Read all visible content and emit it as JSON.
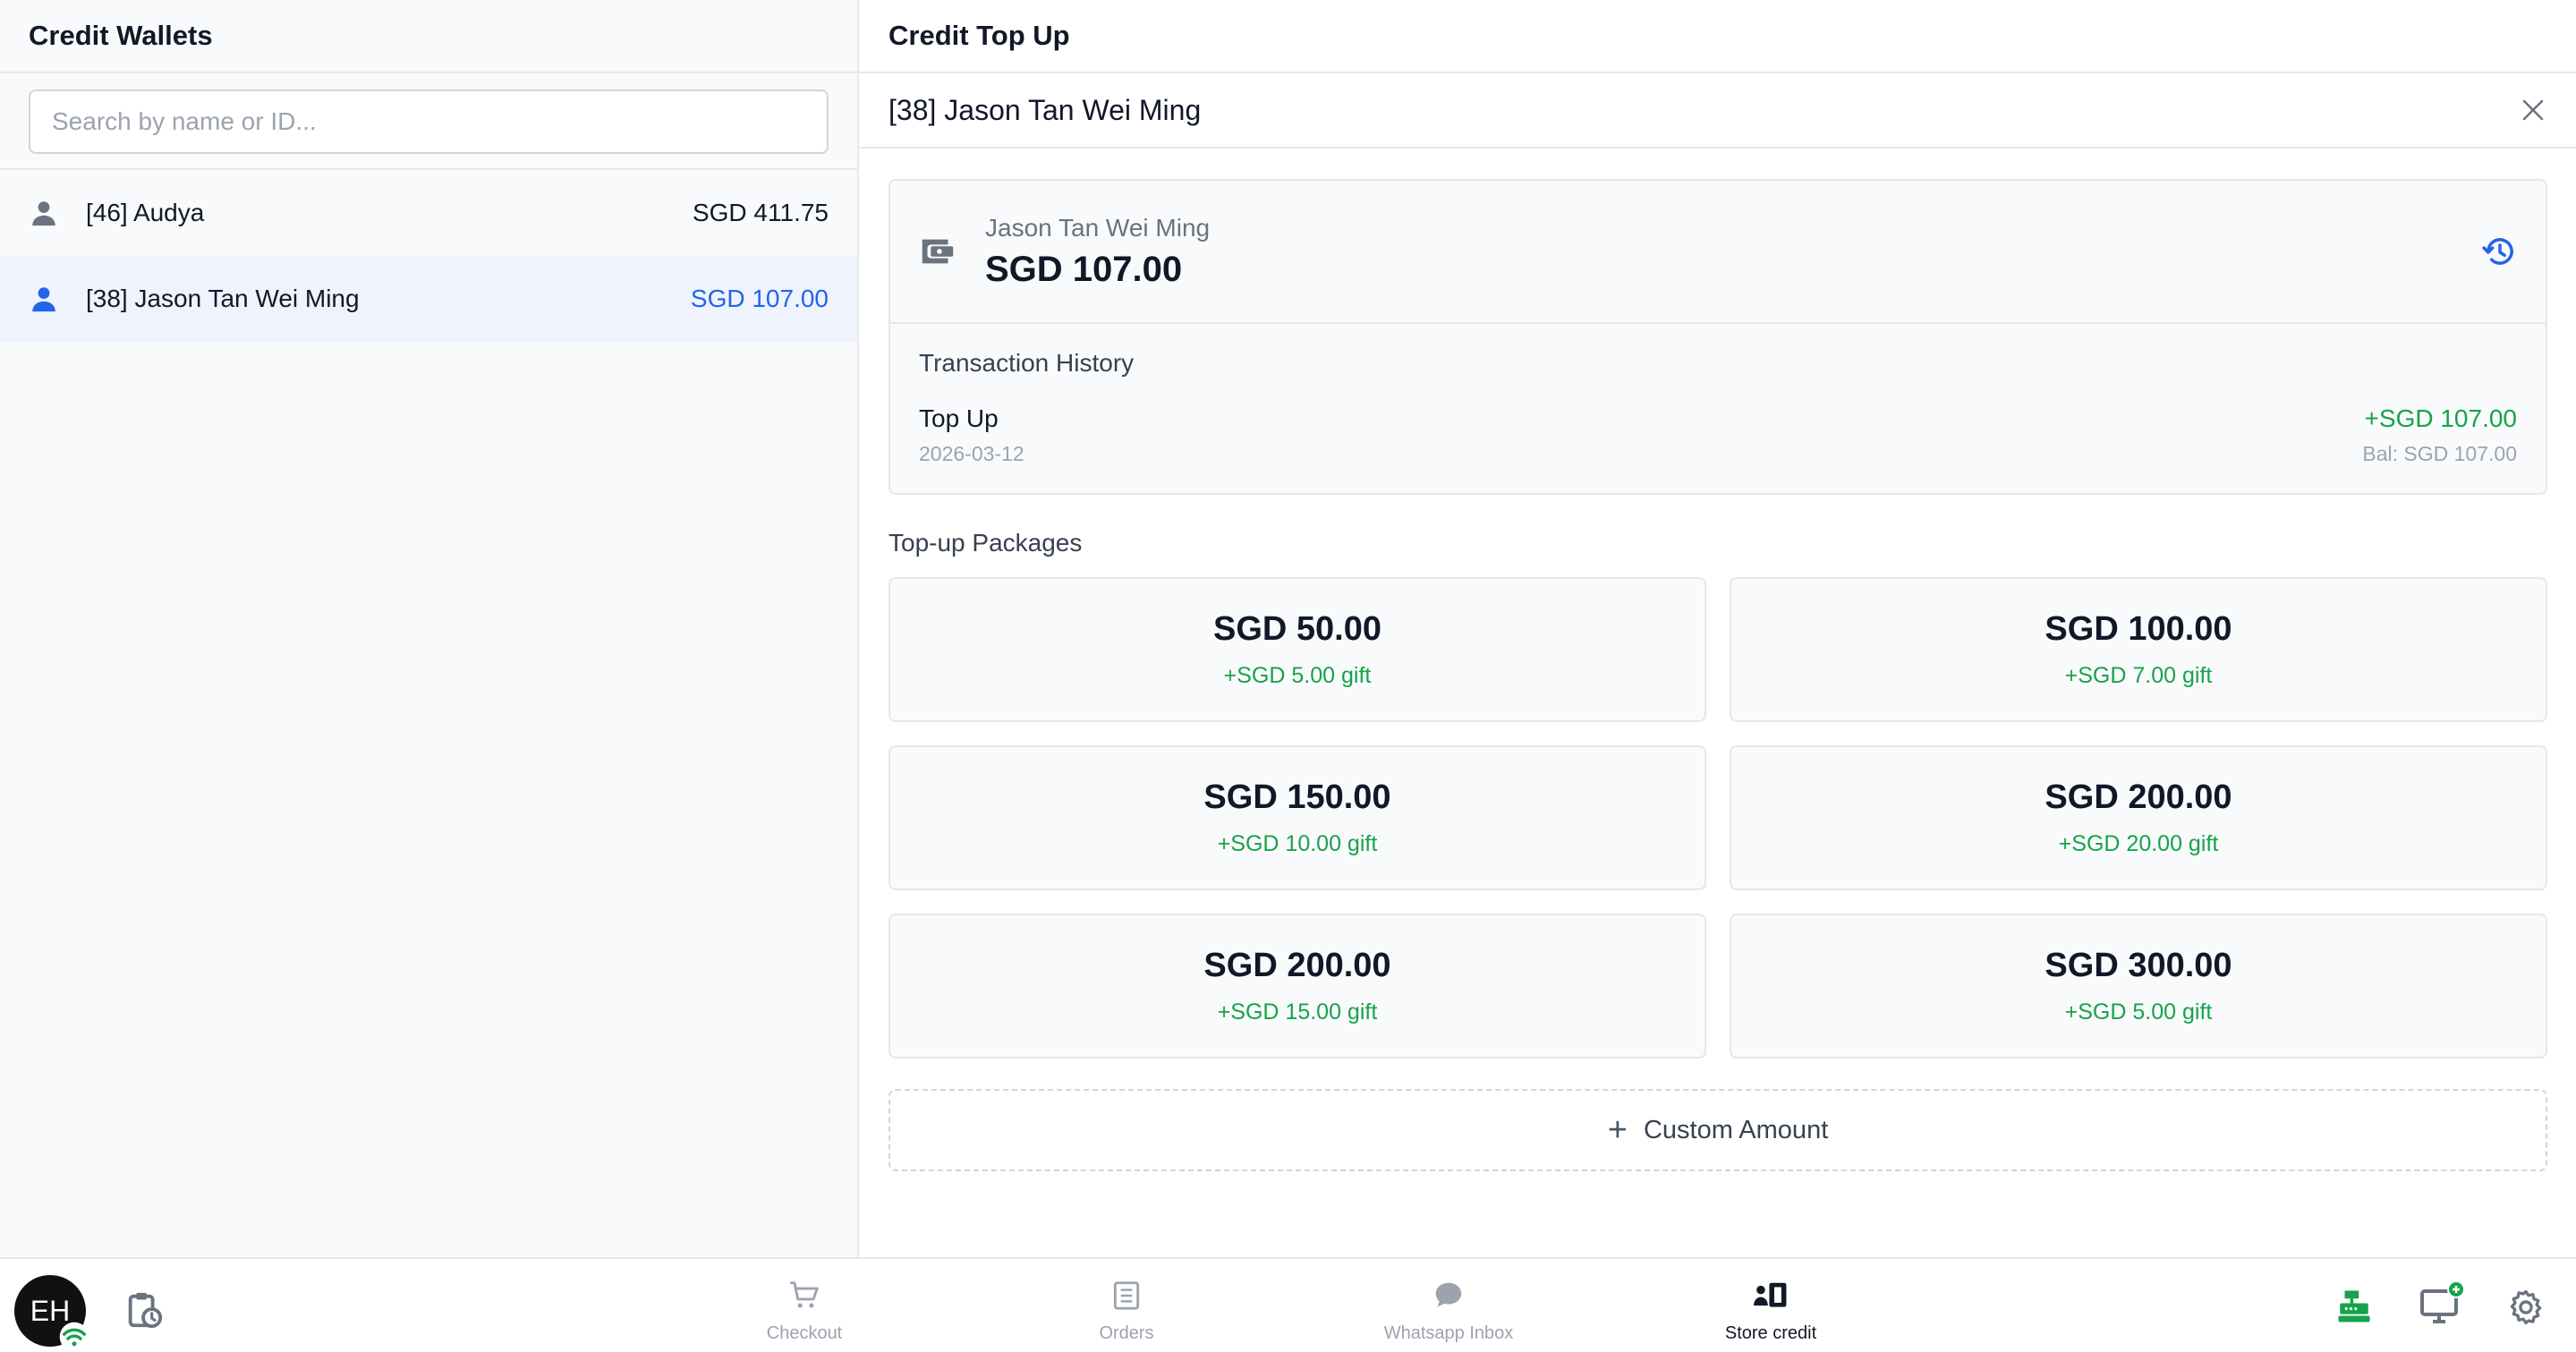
{
  "wallets_panel": {
    "title": "Credit Wallets",
    "search_placeholder": "Search by name or ID...",
    "items": [
      {
        "label": "[46] Audya",
        "balance": "SGD 411.75"
      },
      {
        "label": "[38] Jason Tan Wei Ming",
        "balance": "SGD 107.00"
      }
    ]
  },
  "topup_panel": {
    "title": "Credit Top Up",
    "customer_header": "[38] Jason Tan Wei Ming",
    "wallet": {
      "customer_name": "Jason Tan Wei Ming",
      "balance": "SGD 107.00"
    },
    "history": {
      "title": "Transaction History",
      "items": [
        {
          "type": "Top Up",
          "date": "2026-03-12",
          "amount": "+SGD 107.00",
          "balance": "Bal: SGD 107.00"
        }
      ]
    },
    "packages_title": "Top-up Packages",
    "packages": [
      {
        "amount": "SGD 50.00",
        "gift": "+SGD 5.00 gift"
      },
      {
        "amount": "SGD 100.00",
        "gift": "+SGD 7.00 gift"
      },
      {
        "amount": "SGD 150.00",
        "gift": "+SGD 10.00 gift"
      },
      {
        "amount": "SGD 200.00",
        "gift": "+SGD 20.00 gift"
      },
      {
        "amount": "SGD 200.00",
        "gift": "+SGD 15.00 gift"
      },
      {
        "amount": "SGD 300.00",
        "gift": "+SGD 5.00 gift"
      }
    ],
    "custom_amount_label": "Custom Amount"
  },
  "bottom_nav": {
    "user_initials": "EH",
    "items": [
      {
        "label": "Checkout"
      },
      {
        "label": "Orders"
      },
      {
        "label": "Whatsapp Inbox"
      },
      {
        "label": "Store credit"
      }
    ]
  },
  "colors": {
    "accent": "#2563eb",
    "positive": "#16a34a",
    "active_row_bg": "#eef3fd"
  }
}
